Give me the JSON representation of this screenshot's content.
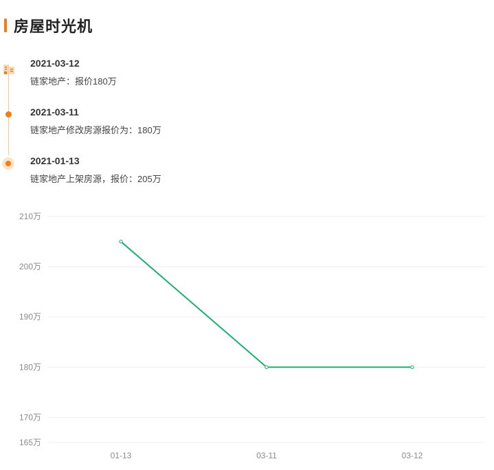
{
  "page": {
    "title": "房屋时光机"
  },
  "timeline": {
    "items": [
      {
        "date": "2021-03-12",
        "desc": "链家地产：报价180万",
        "marker": "house-icon"
      },
      {
        "date": "2021-03-11",
        "desc": "链家地产修改房源报价为：180万",
        "marker": "dot"
      },
      {
        "date": "2021-01-13",
        "desc": "链家地产上架房源，报价：205万",
        "marker": "ring"
      }
    ]
  },
  "colors": {
    "accent": "#f07d17",
    "line": "#1aaf6c",
    "grid": "#eeeeee",
    "axis_text": "#8a8a8a"
  },
  "chart_data": {
    "type": "line",
    "categories": [
      "01-13",
      "03-11",
      "03-12"
    ],
    "series": [
      {
        "values": [
          205,
          180,
          180
        ]
      }
    ],
    "y_ticks": [
      {
        "value": 210,
        "label": "210万"
      },
      {
        "value": 200,
        "label": "200万"
      },
      {
        "value": 190,
        "label": "190万"
      },
      {
        "value": 180,
        "label": "180万"
      },
      {
        "value": 170,
        "label": "170万"
      },
      {
        "value": 165,
        "label": "165万"
      }
    ],
    "ylim": [
      165,
      210
    ],
    "grid": true,
    "legend": "none"
  }
}
